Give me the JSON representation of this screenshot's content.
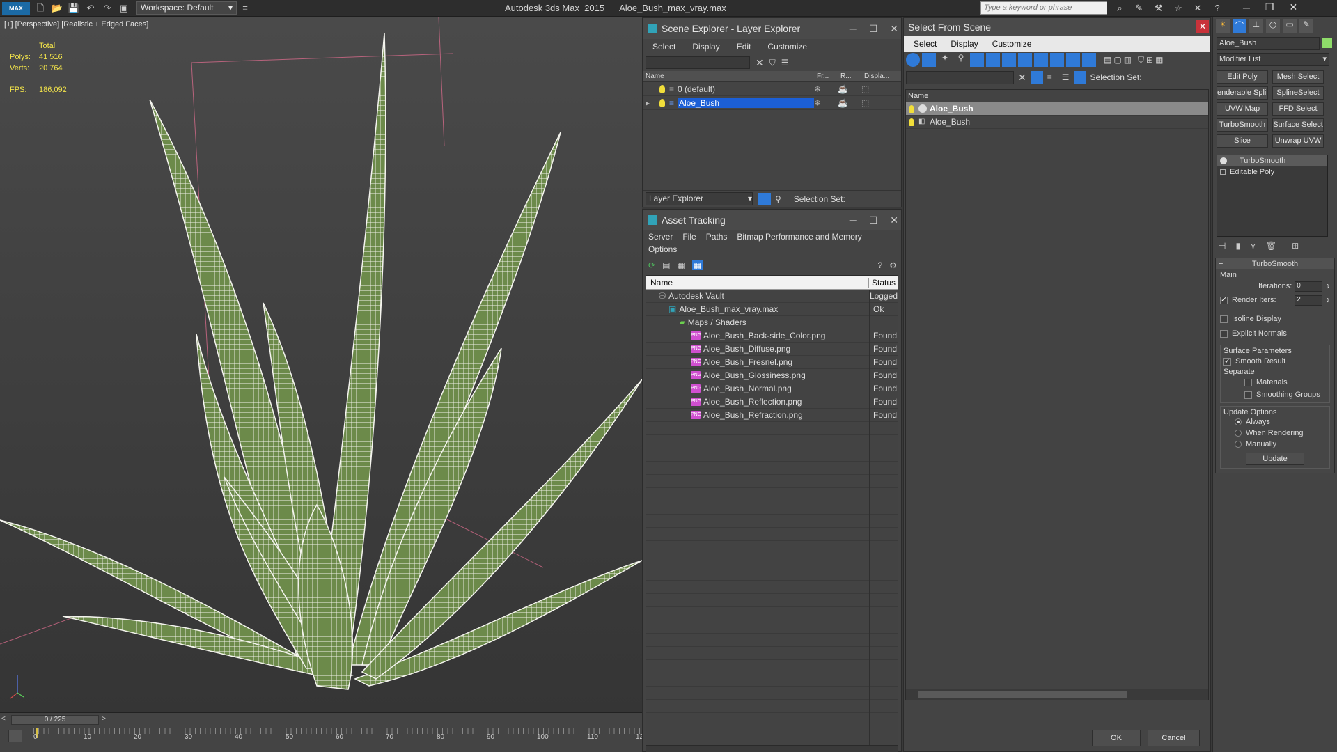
{
  "titlebar": {
    "workspace_label": "Workspace: Default",
    "app_name": "Autodesk 3ds Max  2015",
    "file_name": "Aloe_Bush_max_vray.max",
    "search_placeholder": "Type a keyword or phrase"
  },
  "viewport": {
    "label": "[+] [Perspective] [Realistic + Edged Faces]",
    "stats": {
      "total_label": "Total",
      "polys_label": "Polys:",
      "polys_value": "41 516",
      "verts_label": "Verts:",
      "verts_value": "20 764",
      "fps_label": "FPS:",
      "fps_value": "186,092"
    }
  },
  "timeline": {
    "slider_text": "0 / 225",
    "ticks": [
      "0",
      "10",
      "20",
      "30",
      "40",
      "50",
      "60",
      "70",
      "80",
      "90",
      "100",
      "110",
      "12"
    ]
  },
  "scene_explorer": {
    "title": "Scene Explorer - Layer Explorer",
    "menu": [
      "Select",
      "Display",
      "Edit",
      "Customize"
    ],
    "columns": [
      "Name",
      "Fr...",
      "R...",
      "Displa..."
    ],
    "rows": [
      {
        "name": "0 (default)",
        "selected": false
      },
      {
        "name": "Aloe_Bush",
        "selected": true
      }
    ],
    "footer_dropdown": "Layer Explorer",
    "selection_set_label": "Selection Set:"
  },
  "asset_tracking": {
    "title": "Asset Tracking",
    "menu": [
      "Server",
      "File",
      "Paths",
      "Bitmap Performance and Memory"
    ],
    "menu2": "Options",
    "columns": [
      "Name",
      "Status"
    ],
    "rows": [
      {
        "name": "Autodesk Vault",
        "status": "Logged",
        "type": "vault"
      },
      {
        "name": "Aloe_Bush_max_vray.max",
        "status": "Ok",
        "type": "max"
      },
      {
        "name": "Maps / Shaders",
        "status": "",
        "type": "folder"
      },
      {
        "name": "Aloe_Bush_Back-side_Color.png",
        "status": "Found",
        "type": "png"
      },
      {
        "name": "Aloe_Bush_Diffuse.png",
        "status": "Found",
        "type": "png"
      },
      {
        "name": "Aloe_Bush_Fresnel.png",
        "status": "Found",
        "type": "png"
      },
      {
        "name": "Aloe_Bush_Glossiness.png",
        "status": "Found",
        "type": "png"
      },
      {
        "name": "Aloe_Bush_Normal.png",
        "status": "Found",
        "type": "png"
      },
      {
        "name": "Aloe_Bush_Reflection.png",
        "status": "Found",
        "type": "png"
      },
      {
        "name": "Aloe_Bush_Refraction.png",
        "status": "Found",
        "type": "png"
      }
    ]
  },
  "select_from_scene": {
    "title": "Select From Scene",
    "menu": [
      "Select",
      "Display",
      "Customize"
    ],
    "selection_set_label": "Selection Set:",
    "column_name": "Name",
    "rows": [
      {
        "name": "Aloe_Bush",
        "selected": true
      },
      {
        "name": "Aloe_Bush",
        "selected": false
      }
    ],
    "ok_label": "OK",
    "cancel_label": "Cancel"
  },
  "command_panel": {
    "object_name": "Aloe_Bush",
    "modifier_list_label": "Modifier List",
    "modifier_buttons": [
      "Edit Poly",
      "Mesh Select",
      "enderable Splin",
      "SplineSelect",
      "UVW Map",
      "FFD Select",
      "TurboSmooth",
      "Surface Select",
      "Slice",
      "Unwrap UVW"
    ],
    "stack": [
      "TurboSmooth",
      "Editable Poly"
    ],
    "rollout_title": "TurboSmooth",
    "main_label": "Main",
    "iterations_label": "Iterations:",
    "iterations_value": "0",
    "render_iters_label": "Render Iters:",
    "render_iters_value": "2",
    "isoline_label": "Isoline Display",
    "explicit_normals_label": "Explicit Normals",
    "surface_params_label": "Surface Parameters",
    "smooth_result_label": "Smooth Result",
    "separate_label": "Separate",
    "materials_label": "Materials",
    "smoothing_groups_label": "Smoothing Groups",
    "update_options_label": "Update Options",
    "always_label": "Always",
    "when_rendering_label": "When Rendering",
    "manually_label": "Manually",
    "update_button": "Update"
  },
  "colors": {
    "selection_blue": "#1c5fd6",
    "stat_yellow": "#f2e34a",
    "found_text": "#e8e8e8"
  }
}
